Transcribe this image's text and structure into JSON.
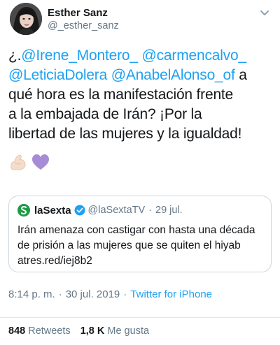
{
  "author": {
    "display_name": "Esther Sanz",
    "handle": "@_esther_sanz"
  },
  "tweet": {
    "lines": [
      [
        {
          "text": "¿.",
          "type": "text"
        },
        {
          "text": "@Irene_Montero_",
          "type": "mention"
        },
        {
          "text": " ",
          "type": "text"
        },
        {
          "text": "@carmencalvo_",
          "type": "mention"
        }
      ],
      [
        {
          "text": "@LeticiaDolera",
          "type": "mention"
        },
        {
          "text": " ",
          "type": "text"
        },
        {
          "text": "@AnabelAlonso_of",
          "type": "mention"
        },
        {
          "text": " a",
          "type": "text"
        }
      ],
      [
        {
          "text": "qué hora es la manifestación frente",
          "type": "text"
        }
      ],
      [
        {
          "text": "a la embajada de Irán? ¡Por la",
          "type": "text"
        }
      ],
      [
        {
          "text": "libertad de las mujeres y la igualdad!",
          "type": "text"
        }
      ]
    ],
    "emojis": [
      "flexed-biceps-light-skin",
      "purple-heart"
    ]
  },
  "quote": {
    "name": "laSexta",
    "handle": "@laSextaTV",
    "separator": "·",
    "date": "29 jul.",
    "lines": [
      "Irán amenaza con castigar con hasta una década",
      "de prisión a las mujeres que se quiten el hiyab",
      "atres.red/iej8b2"
    ]
  },
  "meta": {
    "time": "8:14 p. m.",
    "date": "30 jul. 2019",
    "separator": "·",
    "source": "Twitter for iPhone"
  },
  "stats": {
    "retweets_count": "848",
    "retweets_label": "Retweets",
    "likes_count": "1,8 K",
    "likes_label": "Me gusta"
  },
  "colors": {
    "link": "#1da1f2",
    "secondary_text": "#657786",
    "primary_text": "#14171a",
    "border": "#ccd6dd",
    "brand_green": "#1f9a45",
    "emoji_purple": "#a88bd6"
  }
}
